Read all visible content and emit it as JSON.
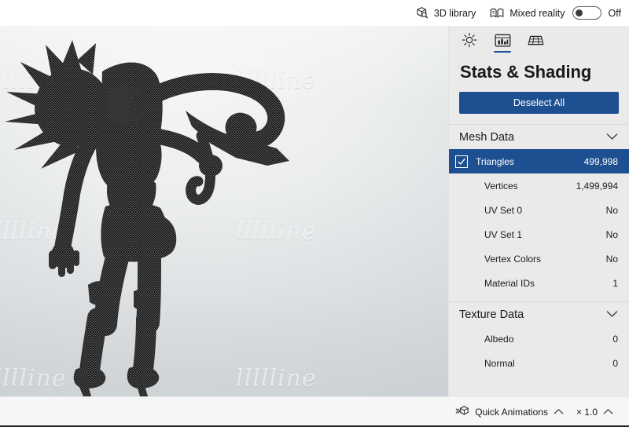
{
  "topbar": {
    "library_label": "3D library",
    "library_icon": "cube-search-icon",
    "mixed_reality_label": "Mixed reality",
    "mixed_reality_icon": "mixed-reality-icon",
    "toggle_state_label": "Off",
    "toggle_on": false
  },
  "viewport": {
    "watermark_text": "llllline",
    "model_name": "armored-warrior-wireframe",
    "background_top": "#f4f5f6",
    "background_bottom": "#cdd2d5"
  },
  "panel": {
    "tabs": [
      {
        "name": "lighting",
        "icon": "sun-icon",
        "active": false
      },
      {
        "name": "stats-shading",
        "icon": "stats-chart-icon",
        "active": true
      },
      {
        "name": "ground-grid",
        "icon": "grid-plane-icon",
        "active": false
      }
    ],
    "title": "Stats & Shading",
    "deselect_label": "Deselect All",
    "accent_color": "#1d4f91",
    "groups": [
      {
        "title": "Mesh Data",
        "expanded": true,
        "chevron": "chevron-down-icon",
        "rows": [
          {
            "label": "Triangles",
            "value": "499,998",
            "selected": true,
            "checked": true
          },
          {
            "label": "Vertices",
            "value": "1,499,994",
            "selected": false,
            "checked": false
          },
          {
            "label": "UV Set 0",
            "value": "No",
            "selected": false,
            "checked": false
          },
          {
            "label": "UV Set 1",
            "value": "No",
            "selected": false,
            "checked": false
          },
          {
            "label": "Vertex Colors",
            "value": "No",
            "selected": false,
            "checked": false
          },
          {
            "label": "Material IDs",
            "value": "1",
            "selected": false,
            "checked": false
          }
        ]
      },
      {
        "title": "Texture Data",
        "expanded": true,
        "chevron": "chevron-down-icon",
        "rows": [
          {
            "label": "Albedo",
            "value": "0",
            "selected": false,
            "checked": false
          },
          {
            "label": "Normal",
            "value": "0",
            "selected": false,
            "checked": false
          }
        ]
      }
    ]
  },
  "footer": {
    "quick_animations_label": "Quick Animations",
    "quick_animations_icon": "animation-cube-icon",
    "quick_animations_chevron": "chevron-up-icon",
    "speed_label": "× 1.0",
    "speed_chevron": "chevron-up-icon"
  }
}
